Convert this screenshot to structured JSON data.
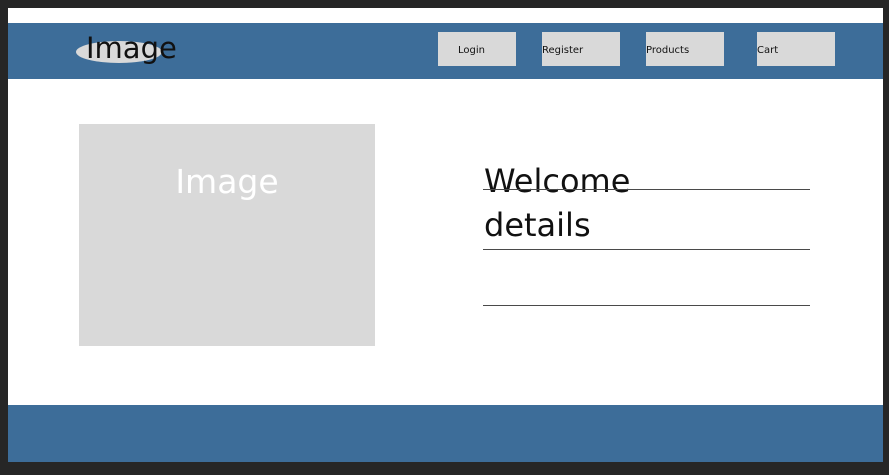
{
  "header": {
    "logo_text": "Image",
    "nav": {
      "login": "Login",
      "register": "Register",
      "products": "Products",
      "cart": "Cart"
    }
  },
  "hero": {
    "image_label": "Image",
    "welcome_line1": "Welcome",
    "welcome_line2": "details"
  },
  "colors": {
    "header_bg": "#3d6d99",
    "placeholder_gray": "#d9d9d9",
    "outer_frame": "#262626"
  }
}
